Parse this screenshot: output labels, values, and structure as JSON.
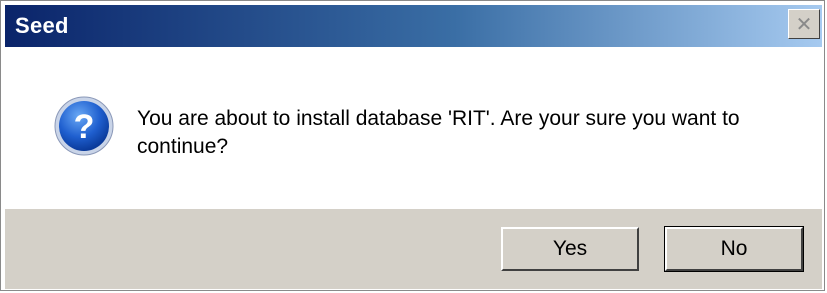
{
  "window": {
    "title": "Seed",
    "close_glyph": "✕"
  },
  "dialog": {
    "icon": "question-icon",
    "message": "You are about to install database 'RIT'. Are your sure you want to continue?"
  },
  "buttons": {
    "yes_label": "Yes",
    "no_label": "No"
  },
  "colors": {
    "titlebar_start": "#0a246a",
    "titlebar_end": "#a6caf0",
    "footer": "#d4d0c8"
  }
}
